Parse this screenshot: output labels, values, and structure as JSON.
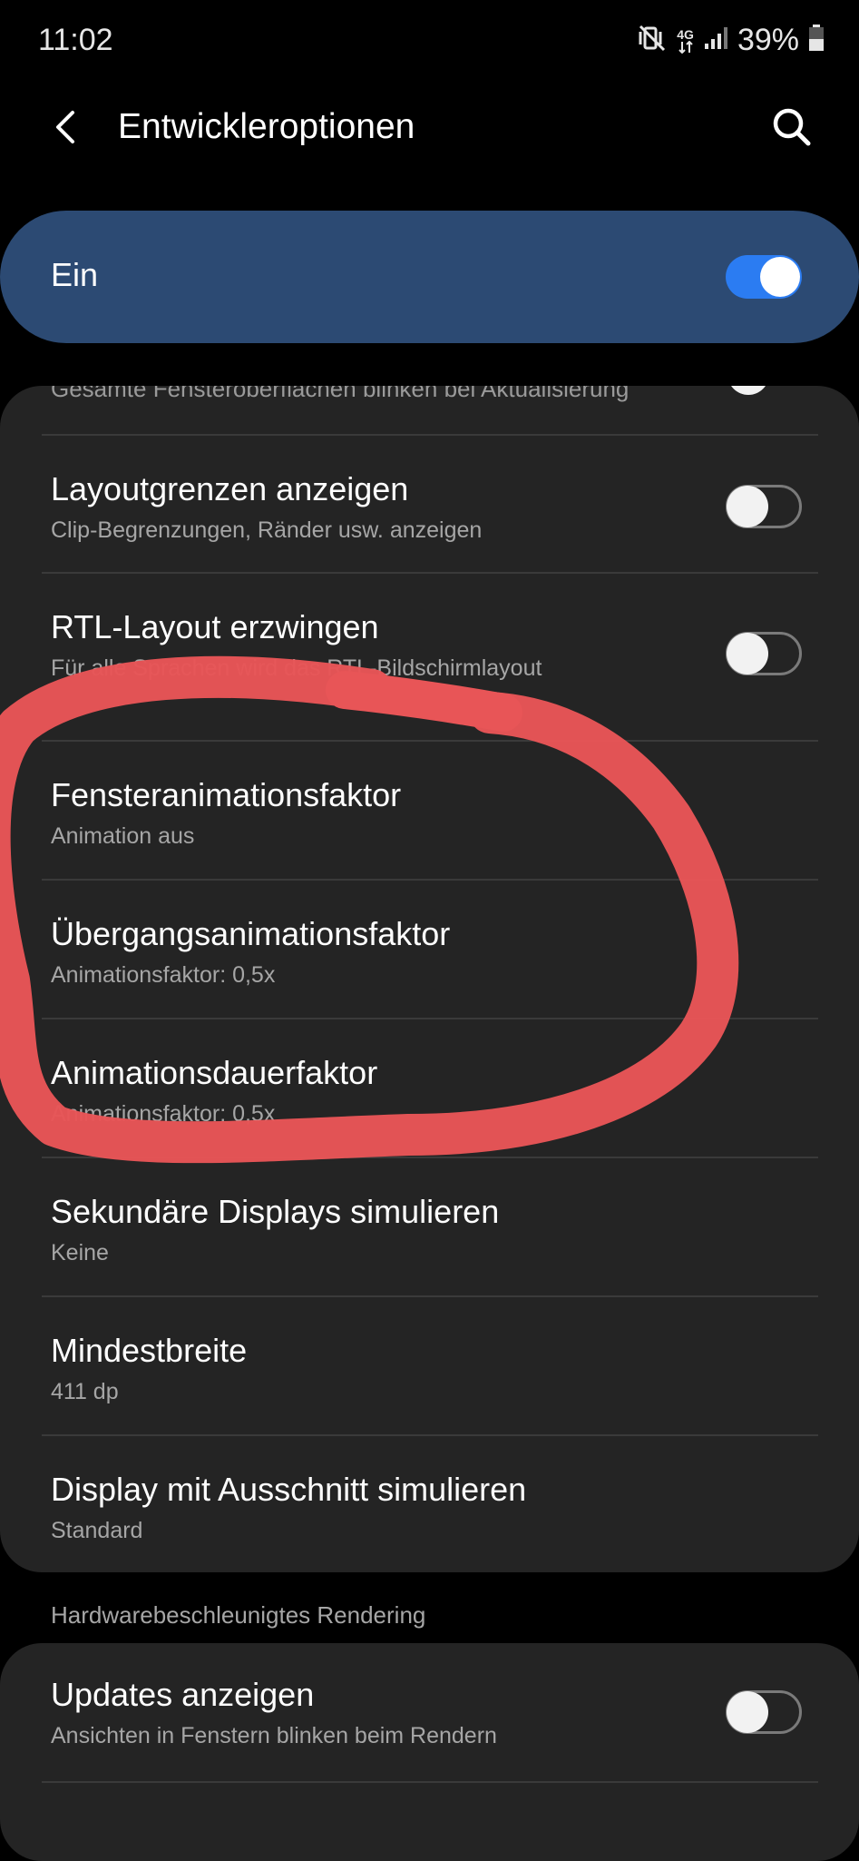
{
  "status_bar": {
    "time": "11:02",
    "network_label": "4G",
    "battery": "39%",
    "icons": [
      "mute-vibrate-icon",
      "4g-data-icon",
      "signal-icon",
      "battery-icon"
    ]
  },
  "header": {
    "title": "Entwickleroptionen",
    "back_icon": "back-arrow-icon",
    "search_icon": "search-icon"
  },
  "master": {
    "label": "Ein",
    "toggle_on": true,
    "accent": "#2b7cf2",
    "bg": "#2c4a73"
  },
  "settings": {
    "partial_item_sub": "Gesamte Fensteroberflächen blinken bei Aktualisierung",
    "items": [
      {
        "title": "Layoutgrenzen anzeigen",
        "subtitle": "Clip-Begrenzungen, Ränder usw. anzeigen",
        "toggle": false
      },
      {
        "title": "RTL-Layout erzwingen",
        "subtitle": "Für alle Sprachen wird das RTL-Bildschirmlayout",
        "toggle": false
      },
      {
        "title": "Fensteranimationsfaktor",
        "subtitle": "Animation aus"
      },
      {
        "title": "Übergangsanimationsfaktor",
        "subtitle": "Animationsfaktor: 0,5x"
      },
      {
        "title": "Animationsdauerfaktor",
        "subtitle": "Animationsfaktor: 0,5x"
      },
      {
        "title": "Sekundäre Displays simulieren",
        "subtitle": "Keine"
      },
      {
        "title": "Mindestbreite",
        "subtitle": "411 dp"
      },
      {
        "title": "Display mit Ausschnitt simulieren",
        "subtitle": "Standard"
      }
    ]
  },
  "hardware_section": {
    "header": "Hardwarebeschleunigtes Rendering",
    "items": [
      {
        "title": "Updates anzeigen",
        "subtitle": "Ansichten in Fenstern blinken beim Rendern",
        "toggle": false
      }
    ]
  },
  "annotation": {
    "shape": "hand-drawn-circle",
    "color": "#e85557"
  }
}
